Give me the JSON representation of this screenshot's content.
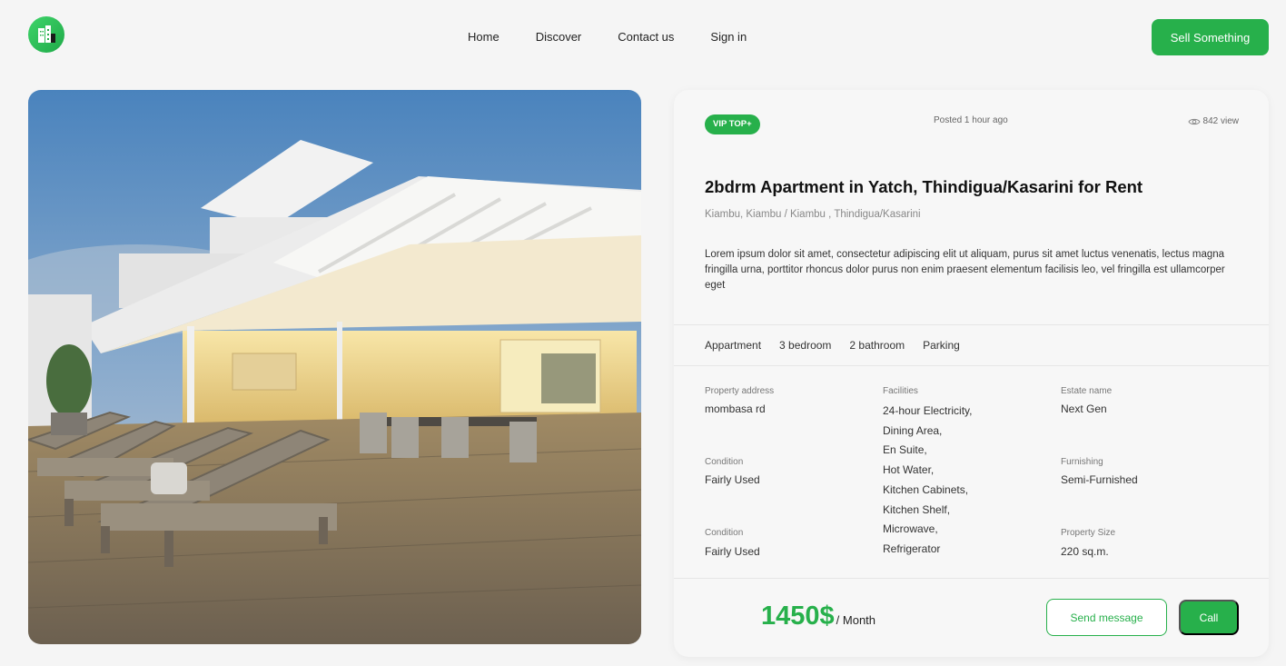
{
  "header": {
    "logo_icon": "building-icon",
    "nav": [
      "Home",
      "Discover",
      "Contact us",
      "Sign in"
    ],
    "sell_button": "Sell Something"
  },
  "listing": {
    "badge": "VIP TOP+",
    "posted": "Posted 1 hour ago",
    "views": "842 view",
    "views_icon": "eye-icon",
    "title": "2bdrm Apartment in Yatch, Thindigua/Kasarini for Rent",
    "location": "Kiambu, Kiambu / Kiambu , Thindigua/Kasarini",
    "description": "Lorem ipsum dolor sit amet, consectetur adipiscing elit ut aliquam, purus sit amet luctus venenatis, lectus magna fringilla urna, porttitor rhoncus dolor purus non enim praesent elementum facilisis leo, vel fringilla est ullamcorper eget",
    "features": [
      "Appartment",
      "3 bedroom",
      "2 bathroom",
      "Parking"
    ],
    "details": {
      "property_address_label": "Property address",
      "property_address": "mombasa rd",
      "condition_label": "Condition",
      "condition": "Fairly Used",
      "condition2_label": "Condition",
      "condition2": "Fairly Used",
      "facilities_label": "Facilities",
      "facilities": [
        "24-hour Electricity,",
        "Dining Area,",
        "En Suite,",
        "Hot Water,",
        "Kitchen Cabinets,",
        "Kitchen Shelf,",
        "Microwave,",
        "Refrigerator"
      ],
      "estate_name_label": "Estate name",
      "estate_name": "Next Gen",
      "furnishing_label": "Furnishing",
      "furnishing": "Semi-Furnished",
      "property_size_label": "Property Size",
      "property_size": "220 sq.m."
    },
    "price": "1450$",
    "price_unit": "/ Month",
    "send_message": "Send message",
    "call": "Call"
  },
  "colors": {
    "accent": "#27b04b",
    "background": "#f5f5f5"
  }
}
